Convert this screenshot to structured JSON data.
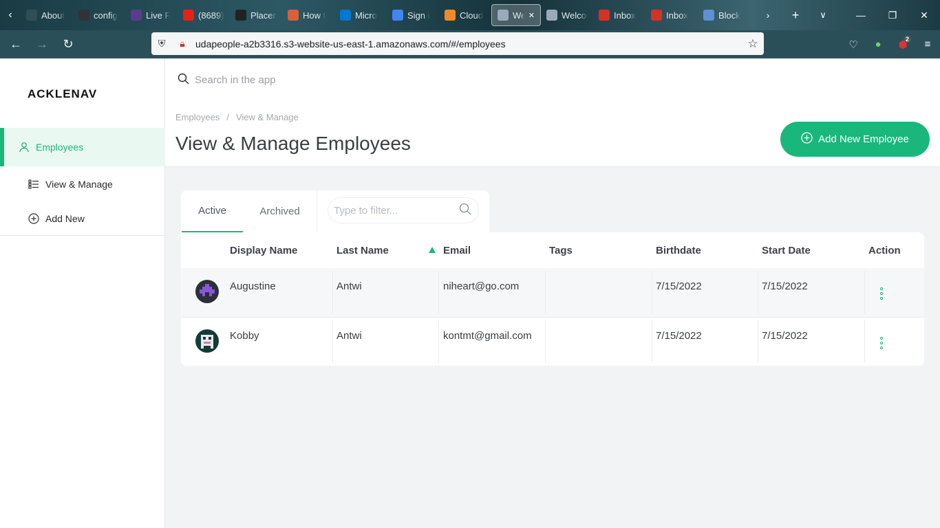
{
  "browser": {
    "tabs": [
      {
        "label": "About",
        "icon": "about-icon",
        "color": "#2f4f55"
      },
      {
        "label": "config",
        "icon": "github-icon",
        "color": "#333333"
      },
      {
        "label": "Live F",
        "icon": "live-icon",
        "color": "#5b3c8c"
      },
      {
        "label": "(8689)",
        "icon": "youtube-icon",
        "color": "#e62117"
      },
      {
        "label": "Placen",
        "icon": "placement-icon",
        "color": "#222222"
      },
      {
        "label": "How t",
        "icon": "how-icon",
        "color": "#d9603b"
      },
      {
        "label": "Micro",
        "icon": "microsoft-icon",
        "color": "#0078d4"
      },
      {
        "label": "Sign i",
        "icon": "google-icon",
        "color": "#4285f4"
      },
      {
        "label": "Cloud",
        "icon": "cloud-icon",
        "color": "#f08a24"
      },
      {
        "label": "Welcon",
        "icon": "welcome-icon",
        "color": "#9ab",
        "active": true
      },
      {
        "label": "Welcome",
        "icon": "welcome-icon",
        "color": "#9ab"
      },
      {
        "label": "Inbox",
        "icon": "gmail-icon",
        "color": "#d93025"
      },
      {
        "label": "Inbox",
        "icon": "gmail-icon",
        "color": "#d93025"
      },
      {
        "label": "Block",
        "icon": "block-icon",
        "color": "#5f8fd6"
      }
    ],
    "url": "udapeople-a2b3316.s3-website-us-east-1.amazonaws.com/#/employees",
    "ublock_badge": "2"
  },
  "app": {
    "logo": "ACKLENAV",
    "sidebar": {
      "items": [
        {
          "label": "Employees"
        },
        {
          "label": "View & Manage"
        },
        {
          "label": "Add New"
        }
      ]
    },
    "search_placeholder": "Search in the app",
    "breadcrumb": [
      "Employees",
      "/",
      "View & Manage"
    ],
    "page_title": "View & Manage Employees",
    "add_button": "Add New Employee",
    "view_tabs": [
      "Active",
      "Archived"
    ],
    "filter_placeholder": "Type to filter...",
    "columns": [
      "Display Name",
      "Last Name",
      "Email",
      "Tags",
      "Birthdate",
      "Start Date",
      "Action"
    ],
    "rows": [
      {
        "display_name": "Augustine",
        "last_name": "Antwi",
        "email": "niheart@go.com",
        "tags": "",
        "birthdate": "7/15/2022",
        "start_date": "7/15/2022"
      },
      {
        "display_name": "Kobby",
        "last_name": "Antwi",
        "email": "kontmt@gmail.com",
        "tags": "",
        "birthdate": "7/15/2022",
        "start_date": "7/15/2022"
      }
    ],
    "accent": "#1db67a"
  }
}
